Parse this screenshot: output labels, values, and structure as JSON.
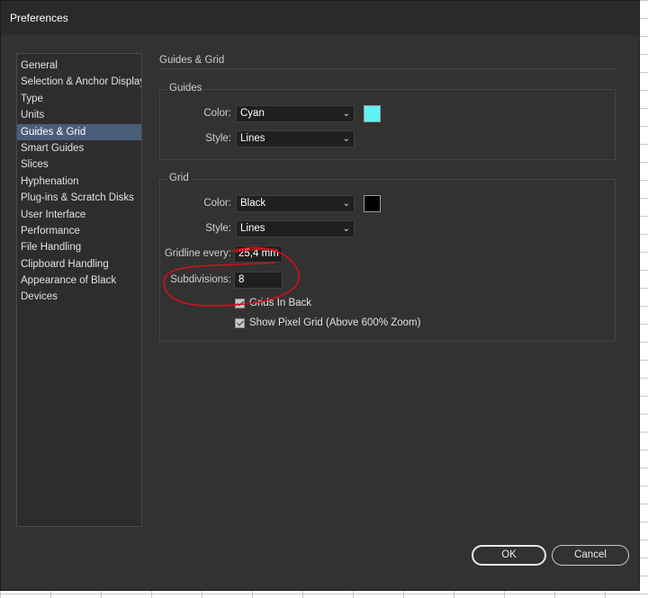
{
  "window": {
    "title": "Preferences"
  },
  "sidebar": {
    "items": [
      {
        "label": "General"
      },
      {
        "label": "Selection & Anchor Display"
      },
      {
        "label": "Type"
      },
      {
        "label": "Units"
      },
      {
        "label": "Guides & Grid",
        "active": true
      },
      {
        "label": "Smart Guides"
      },
      {
        "label": "Slices"
      },
      {
        "label": "Hyphenation"
      },
      {
        "label": "Plug-ins & Scratch Disks"
      },
      {
        "label": "User Interface"
      },
      {
        "label": "Performance"
      },
      {
        "label": "File Handling"
      },
      {
        "label": "Clipboard Handling"
      },
      {
        "label": "Appearance of Black"
      },
      {
        "label": "Devices"
      }
    ]
  },
  "panel": {
    "title": "Guides & Grid",
    "guides": {
      "group_title": "Guides",
      "color_label": "Color:",
      "color_value": "Cyan",
      "color_swatch": "#5ef3f6",
      "style_label": "Style:",
      "style_value": "Lines"
    },
    "grid": {
      "group_title": "Grid",
      "color_label": "Color:",
      "color_value": "Black",
      "color_swatch": "#000000",
      "style_label": "Style:",
      "style_value": "Lines",
      "gridline_label": "Gridline every:",
      "gridline_value": "25,4 mm",
      "subdivisions_label": "Subdivisions:",
      "subdivisions_value": "8",
      "grids_in_back_label": "Grids In Back",
      "grids_in_back_checked": true,
      "pixel_grid_label": "Show Pixel Grid (Above 600% Zoom)",
      "pixel_grid_checked": true
    }
  },
  "buttons": {
    "ok": "OK",
    "cancel": "Cancel"
  },
  "annotation": {
    "color": "#d4101a"
  }
}
